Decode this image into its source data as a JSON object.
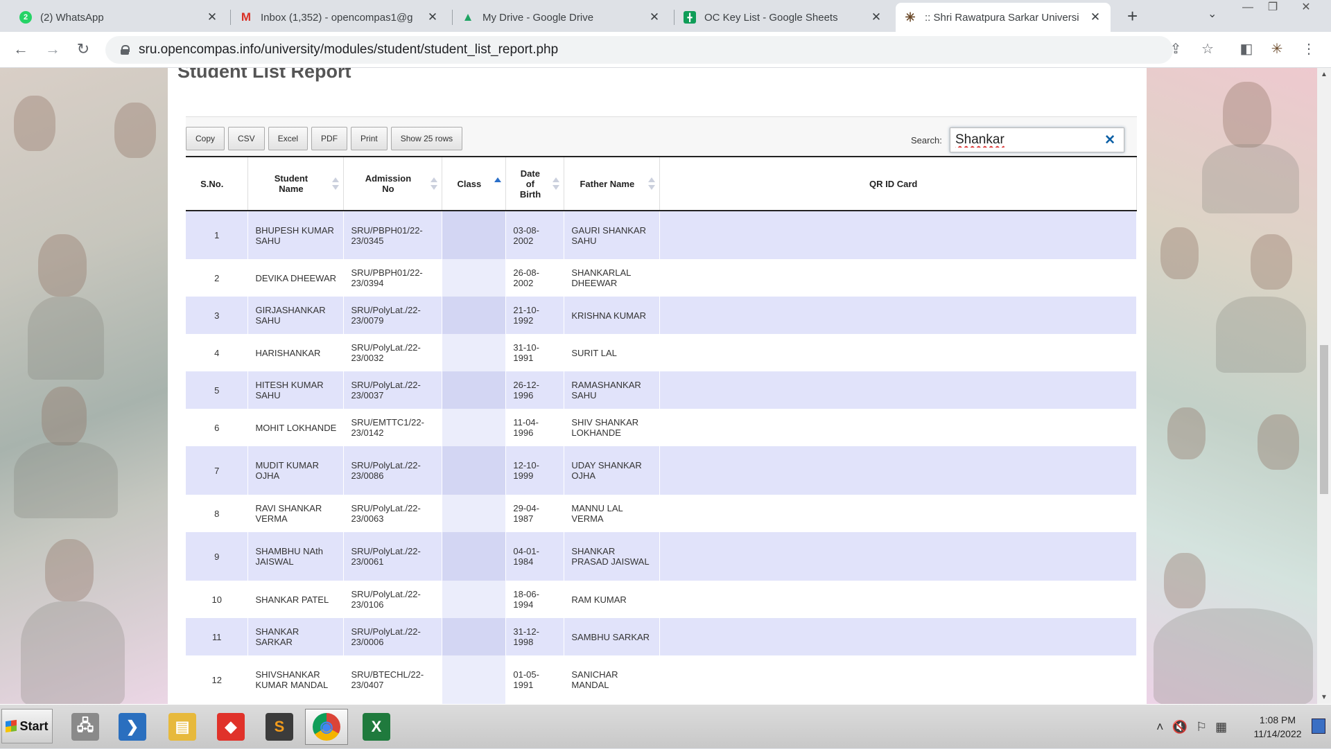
{
  "browser": {
    "tabs": [
      {
        "title": "(2) WhatsApp",
        "icon": "whatsapp-icon",
        "badge": "2",
        "color": "#25d366",
        "active": false
      },
      {
        "title": "Inbox (1,352) - opencompas1@g",
        "icon": "gmail-icon",
        "badge": "M",
        "color": "#d93025",
        "active": false
      },
      {
        "title": "My Drive - Google Drive",
        "icon": "google-drive-icon",
        "badge": "▲",
        "color": "#1fa463",
        "active": false
      },
      {
        "title": "OC Key List - Google Sheets",
        "icon": "google-sheets-icon",
        "badge": "╋",
        "color": "#0f9d58",
        "active": false
      },
      {
        "title": ":: Shri Rawatpura Sarkar Universi",
        "icon": "site-logo-icon",
        "badge": "✳",
        "color": "#6b4a2a",
        "active": true
      }
    ],
    "url": "sru.opencompas.info/university/modules/student/student_list_report.php"
  },
  "page": {
    "heading": "Student List Report",
    "buttons": [
      "Copy",
      "CSV",
      "Excel",
      "PDF",
      "Print",
      "Show 25 rows"
    ],
    "search_label": "Search:",
    "search_value": "Shankar"
  },
  "table": {
    "columns": [
      {
        "label": "S.No.",
        "sortable": false
      },
      {
        "label": "Student Name",
        "sortable": true
      },
      {
        "label": "Admission No",
        "sortable": true
      },
      {
        "label": "Class",
        "sortable": true,
        "sorted": "asc"
      },
      {
        "label": "Date of Birth",
        "sortable": true
      },
      {
        "label": "Father Name",
        "sortable": true
      },
      {
        "label": "QR ID Card",
        "sortable": false
      }
    ],
    "rows": [
      {
        "sno": "1",
        "name": "BHUPESH KUMAR SAHU",
        "adm": "SRU/PBPH01/22-23/0345",
        "class": "",
        "dob": "03-08-2002",
        "father": "GAURI SHANKAR SAHU",
        "qr": ""
      },
      {
        "sno": "2",
        "name": "DEVIKA DHEEWAR",
        "adm": "SRU/PBPH01/22-23/0394",
        "class": "",
        "dob": "26-08-2002",
        "father": "SHANKARLAL DHEEWAR",
        "qr": ""
      },
      {
        "sno": "3",
        "name": "GIRJASHANKAR SAHU",
        "adm": "SRU/PolyLat./22-23/0079",
        "class": "",
        "dob": "21-10-1992",
        "father": "KRISHNA KUMAR",
        "qr": ""
      },
      {
        "sno": "4",
        "name": "HARISHANKAR",
        "adm": "SRU/PolyLat./22-23/0032",
        "class": "",
        "dob": "31-10-1991",
        "father": "SURIT LAL",
        "qr": ""
      },
      {
        "sno": "5",
        "name": "HITESH KUMAR SAHU",
        "adm": "SRU/PolyLat./22-23/0037",
        "class": "",
        "dob": "26-12-1996",
        "father": "RAMASHANKAR SAHU",
        "qr": ""
      },
      {
        "sno": "6",
        "name": "MOHIT LOKHANDE",
        "adm": "SRU/EMTTC1/22-23/0142",
        "class": "",
        "dob": "11-04-1996",
        "father": "SHIV SHANKAR LOKHANDE",
        "qr": ""
      },
      {
        "sno": "7",
        "name": "MUDIT KUMAR OJHA",
        "adm": "SRU/PolyLat./22-23/0086",
        "class": "",
        "dob": "12-10-1999",
        "father": "UDAY SHANKAR OJHA",
        "qr": ""
      },
      {
        "sno": "8",
        "name": "RAVI SHANKAR VERMA",
        "adm": "SRU/PolyLat./22-23/0063",
        "class": "",
        "dob": "29-04-1987",
        "father": "MANNU LAL VERMA",
        "qr": ""
      },
      {
        "sno": "9",
        "name": "SHAMBHU NAth JAISWAL",
        "adm": "SRU/PolyLat./22-23/0061",
        "class": "",
        "dob": "04-01-1984",
        "father": "SHANKAR PRASAD JAISWAL",
        "qr": ""
      },
      {
        "sno": "10",
        "name": "SHANKAR PATEL",
        "adm": "SRU/PolyLat./22-23/0106",
        "class": "",
        "dob": "18-06-1994",
        "father": "RAM KUMAR",
        "qr": ""
      },
      {
        "sno": "11",
        "name": "SHANKAR SARKAR",
        "adm": "SRU/PolyLat./22-23/0006",
        "class": "",
        "dob": "31-12-1998",
        "father": "SAMBHU SARKAR",
        "qr": ""
      },
      {
        "sno": "12",
        "name": "SHIVSHANKAR KUMAR MANDAL",
        "adm": "SRU/BTECHL/22-23/0407",
        "class": "",
        "dob": "01-05-1991",
        "father": "SANICHAR MANDAL",
        "qr": ""
      }
    ]
  },
  "taskbar": {
    "start_label": "Start",
    "apps": [
      {
        "name": "network-computer-icon",
        "glyph": "🖧",
        "color": "#8a8a8a"
      },
      {
        "name": "powershell-icon",
        "glyph": "❯",
        "color": "#2a6fbf"
      },
      {
        "name": "file-explorer-icon",
        "glyph": "▤",
        "color": "#e7b93c"
      },
      {
        "name": "anydesk-icon",
        "glyph": "◆",
        "color": "#e0322a"
      },
      {
        "name": "sublime-text-icon",
        "glyph": "S",
        "color": "#3b3b3b"
      },
      {
        "name": "chrome-icon",
        "glyph": "◉",
        "color": "#e8453c"
      },
      {
        "name": "excel-icon",
        "glyph": "X",
        "color": "#1f7a3d"
      }
    ],
    "time": "1:08 PM",
    "date": "11/14/2022"
  }
}
